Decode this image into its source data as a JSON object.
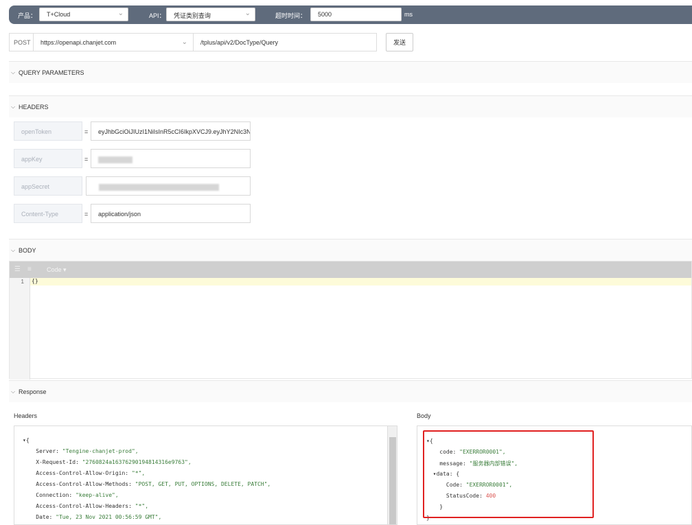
{
  "toolbar": {
    "product_label": "产品：",
    "product_value": "T+Cloud",
    "api_label": "API：",
    "api_value": "凭证类别查询",
    "timeout_label": "超时时间：",
    "timeout_value": "5000",
    "timeout_unit": "ms"
  },
  "request": {
    "method": "POST",
    "base_url": "https://openapi.chanjet.com",
    "path": "/tplus/api/v2/DocType/Query",
    "send_label": "发送"
  },
  "sections": {
    "query": "QUERY PARAMETERS",
    "headers": "HEADERS",
    "body": "BODY",
    "response": "Response"
  },
  "headers": [
    {
      "key": "openToken",
      "eq": "=",
      "value": "eyJhbGciOiJIUzI1NiIsInR5cCI6IkpXVCJ9.eyJhY2NIc3N"
    },
    {
      "key": "appKey",
      "eq": "=",
      "value": ""
    },
    {
      "key": "appSecret",
      "eq": "",
      "value": ""
    },
    {
      "key": "Content-Type",
      "eq": "=",
      "value": "application/json"
    }
  ],
  "editor": {
    "mode_label": "Code ▾",
    "line_no": "1",
    "content": "{}"
  },
  "response": {
    "headers_label": "Headers",
    "body_label": "Body",
    "headers_lines": [
      {
        "k": "▾{",
        "v": "",
        "t": "k"
      },
      {
        "k": "    Server: ",
        "v": "\"Tengine-chanjet-prod\",",
        "t": "s"
      },
      {
        "k": "    X-Request-Id: ",
        "v": "\"2760824a16376290194814316e9763\",",
        "t": "s"
      },
      {
        "k": "    Access-Control-Allow-Origin: ",
        "v": "\"*\",",
        "t": "s"
      },
      {
        "k": "    Access-Control-Allow-Methods: ",
        "v": "\"POST, GET, PUT, OPTIONS, DELETE, PATCH\",",
        "t": "s"
      },
      {
        "k": "    Connection: ",
        "v": "\"keep-alive\",",
        "t": "s"
      },
      {
        "k": "    Access-Control-Allow-Headers: ",
        "v": "\"*\",",
        "t": "s"
      },
      {
        "k": "    Date: ",
        "v": "\"Tue, 23 Nov 2021 00:56:59 GMT\",",
        "t": "s"
      }
    ],
    "body_lines": [
      {
        "k": "▾{",
        "v": "",
        "t": "k"
      },
      {
        "k": "    code: ",
        "v": "\"EXERROR0001\",",
        "t": "s"
      },
      {
        "k": "    message: ",
        "v": "\"服务器内部错误\",",
        "t": "s"
      },
      {
        "k": "  ▾data: {",
        "v": "",
        "t": "k"
      },
      {
        "k": "      Code: ",
        "v": "\"EXERROR0001\",",
        "t": "s"
      },
      {
        "k": "      StatusCode: ",
        "v": "400",
        "t": "n"
      },
      {
        "k": "    }",
        "v": "",
        "t": "k"
      },
      {
        "k": "}",
        "v": "",
        "t": "k"
      }
    ]
  },
  "colors": {
    "topbar": "#5f6b7c",
    "highlight_box": "#e02020",
    "string": "#3a7d3a",
    "number": "#d9534f"
  }
}
